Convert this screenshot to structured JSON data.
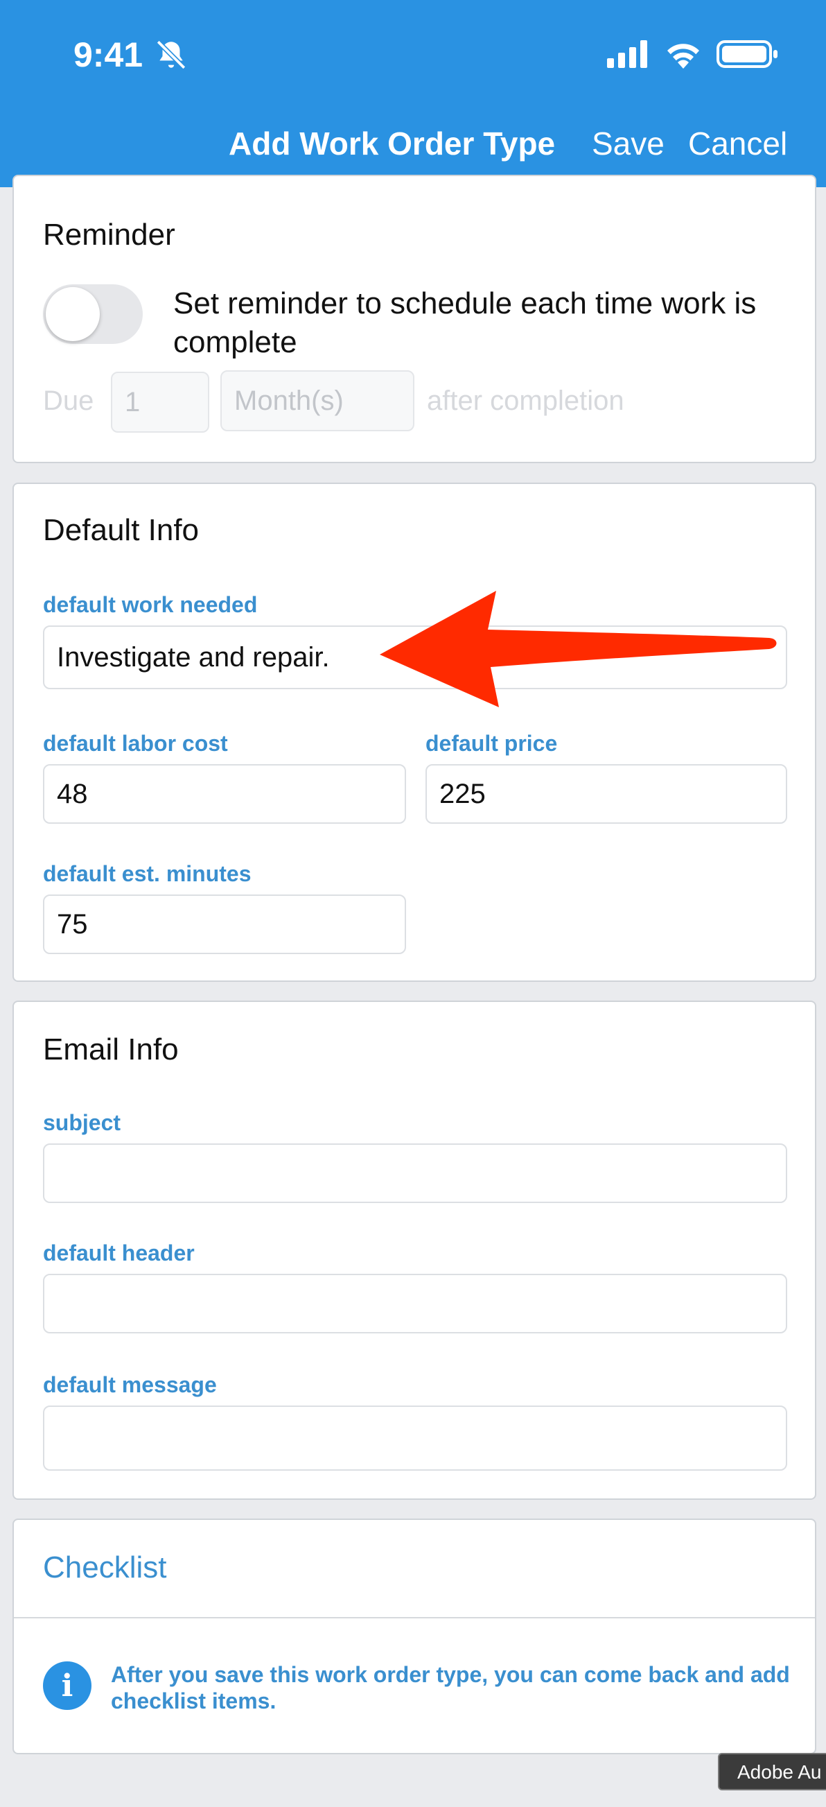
{
  "status_bar": {
    "time": "9:41",
    "icons": [
      "bell-slash-icon",
      "cellular-signal-icon",
      "wifi-icon",
      "battery-icon"
    ]
  },
  "nav": {
    "title": "Add Work Order Type",
    "save_label": "Save",
    "cancel_label": "Cancel"
  },
  "reminder": {
    "title": "Reminder",
    "toggle_on": false,
    "toggle_text": "Set reminder to schedule each time work is complete",
    "due_label": "Due",
    "due_value": "1",
    "unit_placeholder": "Month(s)",
    "after_label": "after completion"
  },
  "default_info": {
    "title": "Default Info",
    "work_needed": {
      "label": "default work needed",
      "value": "Investigate and repair."
    },
    "labor_cost": {
      "label": "default labor cost",
      "value": "48"
    },
    "price": {
      "label": "default price",
      "value": "225"
    },
    "est_minutes": {
      "label": "default est. minutes",
      "value": "75"
    }
  },
  "email_info": {
    "title": "Email Info",
    "subject": {
      "label": "subject",
      "value": ""
    },
    "header": {
      "label": "default header",
      "value": ""
    },
    "message": {
      "label": "default message",
      "value": ""
    }
  },
  "checklist": {
    "title": "Checklist",
    "info_icon": "info-icon",
    "info_text": "After you save this work order type, you can come back and add checklist items."
  },
  "overlay_badge": "Adobe Au",
  "colors": {
    "header_bg": "#2a92e2",
    "label_blue": "#3a8fcf",
    "arrow_red": "#ff2a00",
    "page_bg": "#eaebee"
  }
}
